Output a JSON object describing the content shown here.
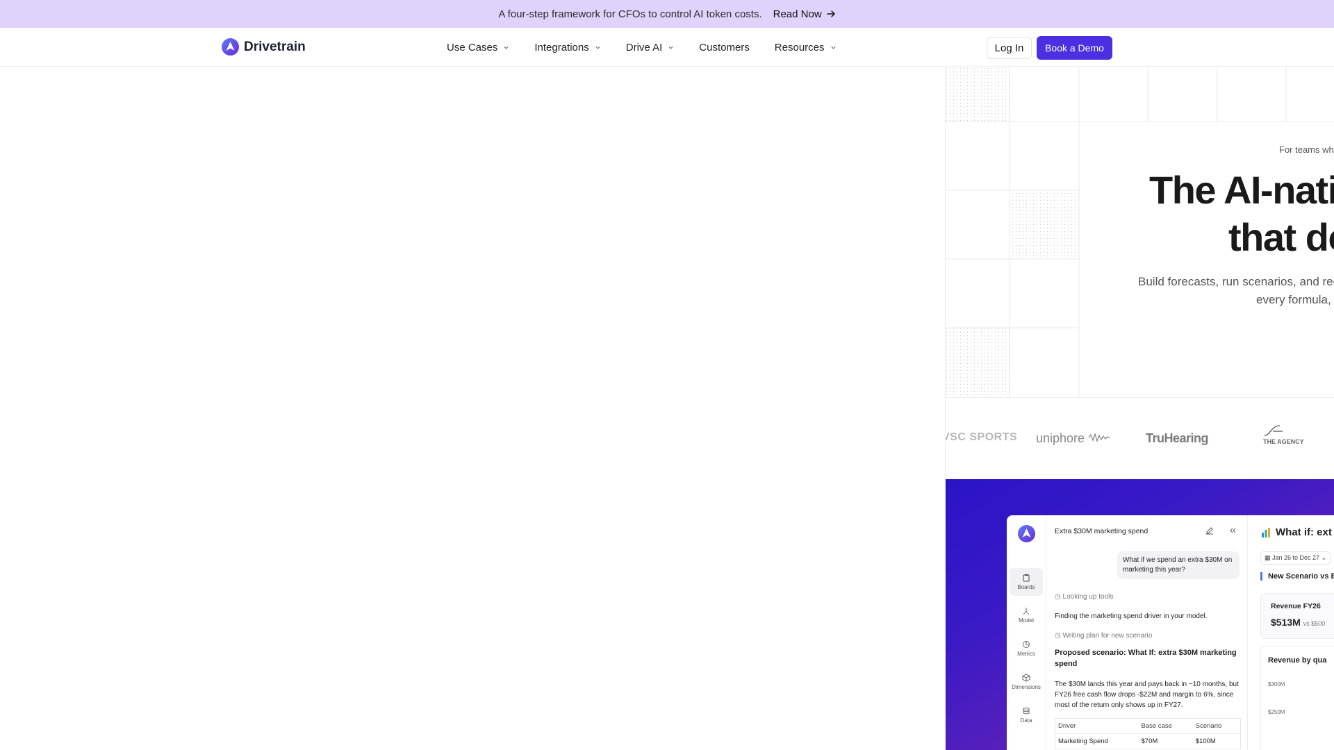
{
  "banner": {
    "message": "A four-step framework for CFOs to control AI token costs.",
    "cta": "Read Now"
  },
  "nav": {
    "brand": "Drivetrain",
    "items": [
      {
        "label": "Use Cases",
        "dropdown": true
      },
      {
        "label": "Integrations",
        "dropdown": true
      },
      {
        "label": "Drive AI",
        "dropdown": true
      },
      {
        "label": "Customers",
        "dropdown": false
      },
      {
        "label": "Resources",
        "dropdown": true
      }
    ],
    "login": "Log In",
    "demo": "Book a Demo"
  },
  "hero": {
    "eyebrow": "For teams who",
    "headline_line1": "The AI-nati",
    "headline_line2": "that do",
    "sub_line1": "Build forecasts, run scenarios, and reco",
    "sub_line2": "every formula, a"
  },
  "logos": [
    "VSC SPORTS",
    "uniphore",
    "TruHearing",
    "THE AGENCY"
  ],
  "app": {
    "rail": [
      {
        "label": "Boards",
        "icon": "clipboard-icon"
      },
      {
        "label": "Model",
        "icon": "model-icon"
      },
      {
        "label": "Metrics",
        "icon": "pie-icon"
      },
      {
        "label": "Dimensions",
        "icon": "cube-icon"
      },
      {
        "label": "Data",
        "icon": "database-icon"
      }
    ],
    "chat": {
      "title": "Extra $30M marketing spend",
      "user_message": "What if we spend an extra $30M on marketing this year?",
      "step1": "Looking up tools",
      "line1": "Finding the marketing spend driver in your model.",
      "step2": "Writing plan for new scenario",
      "proposal": "Proposed scenario: What If: extra $30M marketing spend",
      "summary": "The $30M lands this year and pays back in ~10 months, but FY26 free cash flow drops -$22M and margin to 6%, since most of the return only shows up in FY27.",
      "table_headers": [
        "Driver",
        "Base case",
        "Scenario"
      ],
      "table_rows": [
        [
          "Marketing Spend",
          "$70M",
          "$100M"
        ]
      ]
    },
    "side": {
      "title": "What if: ext",
      "date_range": "Jan 26 to Dec 27",
      "scenario_label": "New Scenario vs B",
      "kpi_title": "Revenue FY26",
      "kpi_value": "$513M",
      "kpi_compare": "vs $500",
      "chart_title": "Revenue by qua",
      "ticks": [
        "$300M",
        "$250M"
      ]
    }
  },
  "colors": {
    "banner_bg": "#dfd3fb",
    "accent": "#4b2fe0"
  }
}
